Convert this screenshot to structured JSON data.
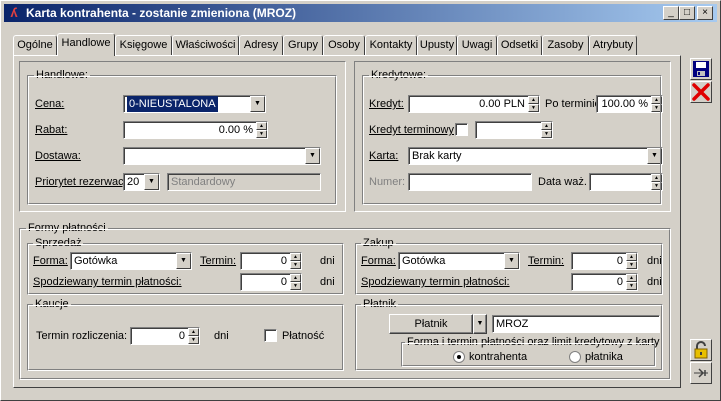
{
  "window": {
    "title": "Karta kontrahenta - zostanie zmieniona (MROZ)",
    "minimize": "_",
    "maximize": "□",
    "close": "×"
  },
  "tabs": [
    "Ogólne",
    "Handlowe",
    "Księgowe",
    "Właściwości",
    "Adresy",
    "Grupy",
    "Osoby",
    "Kontakty",
    "Upusty",
    "Uwagi",
    "Odsetki",
    "Zasoby",
    "Atrybuty"
  ],
  "active_tab": "Handlowe",
  "handlowe": {
    "legend": "Handlowe:",
    "cena_label": "Cena:",
    "cena_value": "0-NIEUSTALONA",
    "rabat_label": "Rabat:",
    "rabat_value": "0.00 %",
    "dostawa_label": "Dostawa:",
    "dostawa_value": "",
    "priorytet_label": "Priorytet rezerwacji:",
    "priorytet_value": "20",
    "priorytet_name": "Standardowy"
  },
  "kredytowe": {
    "legend": "Kredytowe:",
    "kredyt_label": "Kredyt:",
    "kredyt_value": "0.00 PLN",
    "po_terminie_label": "Po terminie:",
    "po_terminie_value": "100.00 %",
    "kredyt_terminowy_label": "Kredyt terminowy",
    "kredyt_terminowy_value": "",
    "karta_label": "Karta:",
    "karta_value": "Brak karty",
    "numer_label": "Numer:",
    "numer_value": "",
    "data_waz_label": "Data waż.",
    "data_waz_value": ""
  },
  "formy": {
    "legend": "Formy płatności",
    "sprzedaz": {
      "legend": "Sprzedaż",
      "forma_label": "Forma:",
      "forma_value": "Gotówka",
      "termin_label": "Termin:",
      "termin_value": "0",
      "unit": "dni",
      "spodziewany_label": "Spodziewany termin płatności:",
      "spodziewany_value": "0",
      "unit2": "dni"
    },
    "zakup": {
      "legend": "Zakup",
      "forma_label": "Forma:",
      "forma_value": "Gotówka",
      "termin_label": "Termin:",
      "termin_value": "0",
      "unit": "dni",
      "spodziewany_label": "Spodziewany termin płatności:",
      "spodziewany_value": "0",
      "unit2": "dni"
    },
    "kaucje": {
      "legend": "Kaucje",
      "termin_label": "Termin rozliczenia:",
      "termin_value": "0",
      "unit": "dni",
      "platnosc_label": "Płatność"
    },
    "platnik": {
      "legend": "Płatnik",
      "button_label": "Płatnik",
      "value": "MROZ",
      "sub_legend": "Forma i termin płatności oraz  limit kredytowy z karty",
      "radio_kontrahenta": "kontrahenta",
      "radio_platnika": "płatnika",
      "selected": "kontrahenta"
    }
  },
  "colors": {
    "titlebar_start": "#0a246a",
    "titlebar_end": "#a6caf0",
    "face": "#d4d0c8",
    "selection": "#0a246a",
    "cancel_red": "#e00000",
    "save_blue": "#00007f",
    "lock_yellow": "#e8c000"
  },
  "icons": {
    "app": "app-icon",
    "save": "floppy-disk-icon",
    "cancel": "red-x-icon",
    "lock": "padlock-icon",
    "attach": "attach-icon"
  }
}
